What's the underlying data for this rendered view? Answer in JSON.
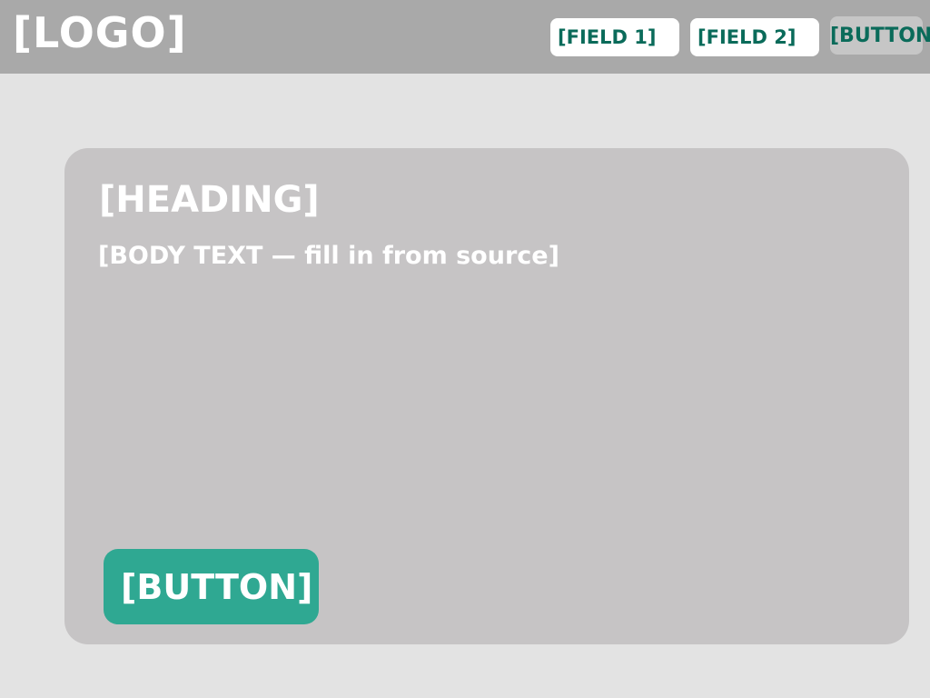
{
  "header": {
    "logo": "[LOGO]",
    "username_placeholder": "[FIELD 1]",
    "password_placeholder": "[FIELD 2]",
    "login_label": "[BUTTON]"
  },
  "card": {
    "title": "[HEADING]",
    "body": "[BODY TEXT — fill in from source]",
    "back_label": "[BUTTON]"
  },
  "colors": {
    "topbar": "#a9a9a9",
    "page_background": "#e3e3e3",
    "card_background": "#c6c4c5",
    "accent_button": "#2fa892",
    "field_text": "#0a6b5a"
  }
}
